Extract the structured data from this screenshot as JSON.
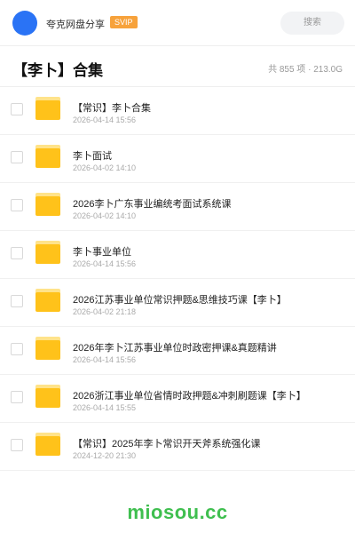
{
  "header": {
    "app_name": "夸克网盘分享",
    "badge": "SVIP",
    "search_placeholder": "搜索",
    "avatar_color": "#2a73f5",
    "badge_color": "#f7a23b"
  },
  "folder": {
    "title": "【李卜】合集",
    "stats": "共 855 项 · 213.0G"
  },
  "items": [
    {
      "name": "【常识】李卜合集",
      "date": "2026-04-14 15:56",
      "icon": "folder-icon"
    },
    {
      "name": "李卜面试",
      "date": "2026-04-02 14:10",
      "icon": "folder-icon"
    },
    {
      "name": "2026李卜广东事业编统考面试系统课",
      "date": "2026-04-02 14:10",
      "icon": "folder-icon"
    },
    {
      "name": "李卜事业单位",
      "date": "2026-04-14 15:56",
      "icon": "folder-icon"
    },
    {
      "name": "2026江苏事业单位常识押题&思维技巧课【李卜】",
      "date": "2026-04-02 21:18",
      "icon": "folder-icon"
    },
    {
      "name": "2026年李卜江苏事业单位时政密押课&真题精讲",
      "date": "2026-04-14 15:56",
      "icon": "folder-icon"
    },
    {
      "name": "2026浙江事业单位省情时政押题&冲刺刷题课【李卜】",
      "date": "2026-04-14 15:55",
      "icon": "folder-icon"
    },
    {
      "name": "【常识】2025年李卜常识开天斧系统强化课",
      "date": "2024-12-20 21:30",
      "icon": "folder-icon"
    }
  ],
  "footer": {
    "watermark": "miosou.cc",
    "watermark_color": "#3fbf4f"
  }
}
